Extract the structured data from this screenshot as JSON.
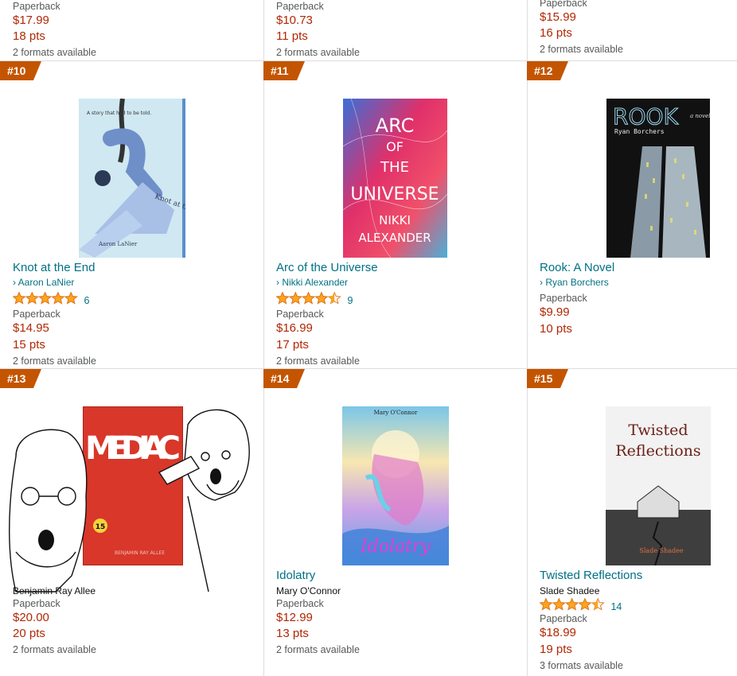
{
  "top_row": [
    {
      "format": "Paperback",
      "price": "$17.99",
      "pts": "18 pts",
      "formats": "2 formats available"
    },
    {
      "format": "Paperback",
      "price": "$10.73",
      "pts": "11 pts",
      "formats": "2 formats available"
    },
    {
      "format": "Paperback",
      "price": "$15.99",
      "pts": "16 pts",
      "formats": "2 formats available"
    }
  ],
  "items": [
    {
      "rank": "#10",
      "title": "Knot at the End",
      "author": "Aaron LaNier",
      "rating_count": "6",
      "rating": 5,
      "format": "Paperback",
      "price": "$14.95",
      "pts": "15 pts",
      "formats": "2 formats available",
      "cover": {
        "text1": "A story that had to be told.",
        "text2": "Knot at the End",
        "text3": "Aaron LaNier"
      }
    },
    {
      "rank": "#11",
      "title": "Arc of the Universe",
      "author": "Nikki Alexander",
      "rating_count": "9",
      "rating": 4.5,
      "format": "Paperback",
      "price": "$16.99",
      "pts": "17 pts",
      "formats": "2 formats available",
      "cover": {
        "l1": "ARC",
        "l2": "OF",
        "l3": "THE",
        "l4": "UNIVERSE",
        "l5": "NIKKI",
        "l6": "ALEXANDER"
      }
    },
    {
      "rank": "#12",
      "title": "Rook: A Novel",
      "author": "Ryan Borchers",
      "format": "Paperback",
      "price": "$9.99",
      "pts": "10 pts",
      "cover": {
        "title": "ROOK",
        "sub": "a novel",
        "author": "Ryan Borchers"
      }
    },
    {
      "rank": "#13",
      "author": "Benjamin Ray Allee",
      "format": "Paperback",
      "price": "$20.00",
      "pts": "20 pts",
      "formats": "2 formats available",
      "cover": {
        "title": "MEDIAC",
        "sticker": "15",
        "author": "BENJAMIN RAY ALLEE"
      }
    },
    {
      "rank": "#14",
      "title": "Idolatry",
      "author": "Mary O'Connor",
      "format": "Paperback",
      "price": "$12.99",
      "pts": "13 pts",
      "formats": "2 formats available",
      "cover": {
        "author": "Mary O'Connor",
        "title": "Idolatry"
      }
    },
    {
      "rank": "#15",
      "title": "Twisted Reflections",
      "author": "Slade Shadee",
      "rating_count": "14",
      "rating": 4.5,
      "format": "Paperback",
      "price": "$18.99",
      "pts": "19 pts",
      "formats": "3 formats available",
      "cover": {
        "l1": "Twisted",
        "l2": "Reflections",
        "author": "Slade Shadee"
      }
    }
  ],
  "colors": {
    "badge": "#C45500",
    "link": "#007185",
    "price": "#B12704",
    "star": "#FFA41C",
    "star_outline": "#DE7921"
  },
  "icons": {
    "chevron": "chevron-right-icon",
    "star": "star-icon",
    "meme": "wojak-pointing-meme"
  }
}
